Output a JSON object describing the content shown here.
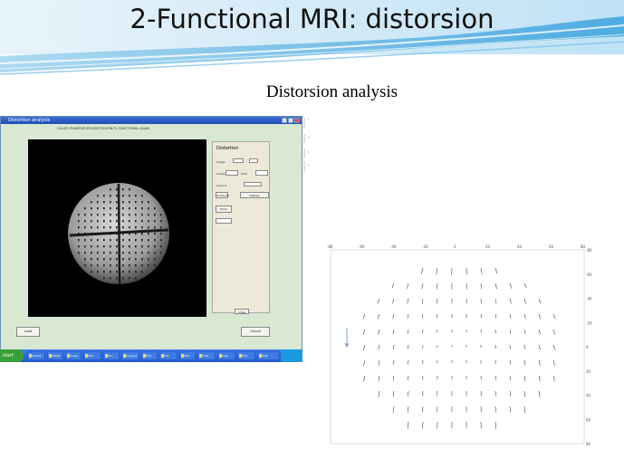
{
  "slide": {
    "title": "2-Functional MRI: distorsion",
    "subtitle": "Distorsion analysis"
  },
  "app_window": {
    "title": "Distortion analysis",
    "image_header": "CALICE-PHANTOM-EPI-DISTORSION-T2-FUNCTIONAL-64x64",
    "panel": {
      "title": "Distortion",
      "rows": [
        "Image",
        "Center",
        "Slice",
        "Level X",
        "Level Y",
        "Distortion",
        "Threshold"
      ],
      "buttons": [
        "Compute",
        "Display",
        "Show",
        "Close"
      ]
    },
    "buttons": {
      "left": "Load",
      "right": "Cancel"
    },
    "colors": {
      "window_bg": "#d8e8d3",
      "panel_bg": "#ece9d8",
      "titlebar": "#2a5cc7"
    }
  },
  "taskbar": {
    "start_label": "start",
    "items": [
      "Dossier",
      "Matlab",
      "Image",
      "Mail",
      "Doc",
      "Analysis",
      "Dist",
      "Plot",
      "Files",
      "Slide",
      "View",
      "Edit",
      "Data"
    ]
  },
  "plot": {
    "x_ticks": [
      "-80",
      "-60",
      "-40",
      "-20",
      "0",
      "20",
      "40",
      "60",
      "80"
    ],
    "y_ticks": [
      "-80",
      "-60",
      "-40",
      "-20",
      "0",
      "20",
      "40",
      "60",
      "80"
    ]
  }
}
